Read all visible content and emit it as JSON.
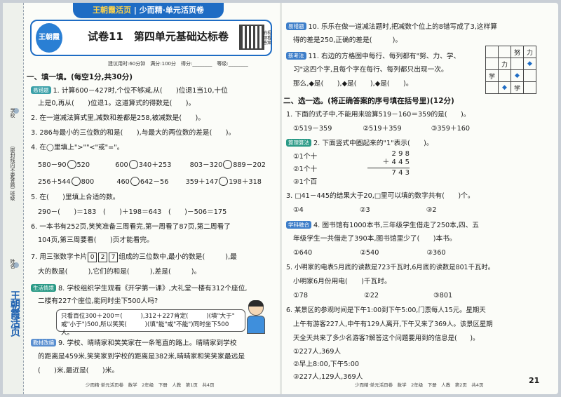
{
  "banner": {
    "brand": "王朝霞活页",
    "series": "少而精·单元活页卷"
  },
  "logo": {
    "text": "王朝霞"
  },
  "title": "试卷11　第四单元基础达标卷",
  "qr_note": "拍视频看答案",
  "meta": "建议用时:60分钟　满分:100分　得分:________　等级:________",
  "binding": {
    "school": "学校",
    "class": "班级",
    "name": "姓名",
    "note": "（密封线内不要答题）",
    "brand": "王朝霞活页"
  },
  "sec1": "一、填一填。(每空1分,共30分)",
  "q1": {
    "tag": "易错题",
    "l1": "1. 计算600－427时,个位不够减,从(　　)位退1当10,十位",
    "l2": "上是0,再从(　　)位退1。这道算式的得数是(　　)。"
  },
  "q2": "2. 在一道减法算式里,减数和差都是258,被减数是(　　)。",
  "q3": "3. 286与最小的三位数的和是(　　),与最大的两位数的差是(　　)。",
  "q4": {
    "l1": "4. 在◯里填上\">\"\"<\"或\"=\"。",
    "r1": [
      "580－90",
      "520",
      "600",
      "340＋253",
      "803－320",
      "889－202"
    ],
    "r2": [
      "256＋544",
      "800",
      "460",
      "642－56",
      "359＋147",
      "198＋318"
    ]
  },
  "q5": {
    "l1": "5. 在(　　)里填上合适的数。",
    "l2": "290－(　　)＝183　(　　)＋198＝643　(　　)－506＝175"
  },
  "q6": {
    "l1": "6. 一本书有252页,笑笑准备三周看完,第一周看了87页,第二周看了",
    "l2": "104页,第三周要看(　　)页才能看完。"
  },
  "q7": {
    "pre": "7. 用三张数字卡片",
    "cards": [
      "0",
      "2",
      "7"
    ],
    "post": "组成的三位数中,最小的数是(　　　),最",
    "l2": "大的数是(　　　),它们的和是(　　　),差是(　　　)。"
  },
  "q8": {
    "tag": "生活情境",
    "l1": "8. 学校组织学生观看《开学第一课》,大礼堂一楼有312个座位,",
    "l2": "二楼有227个座位,能同时坐下500人吗?",
    "h1": "只看百位300＋200＝(　　　),312＋227肯定(　　　)(填\"大于\"",
    "h2": "或\"小于\")500,所以笑笑(　　　)(填\"能\"或\"不能\")同时坐下500人。"
  },
  "q9": {
    "tag": "教材改编",
    "l1": "9. 学校、晴晴家和笑笑家在一条笔直的路上。晴晴家到学校",
    "l2": "的距离是459米,笑笑家到学校的距离是382米,晴晴家和笑笑家最远是",
    "l3": "(　　)米,最近是(　　)米。"
  },
  "q10": {
    "tag": "易错题",
    "l1": "10. 乐乐在做一道减法题时,把减数个位上的8错写成了3,这样算",
    "l2": "得的差是250,正确的差是(　　　)。"
  },
  "q11": {
    "tag": "新考法",
    "l1": "11. 右边的方格图中每行、每列都有\"努、力、学、",
    "l2": "习\"这四个字,且每个字在每行、每列都只出现一次。",
    "l3": "那么,◆是(　　),◆是(　　),◆是(　　)。"
  },
  "grid": [
    [
      "",
      "",
      "努",
      "力"
    ],
    [
      "",
      "力",
      "",
      "◆"
    ],
    [
      "学",
      "",
      "◆",
      ""
    ],
    [
      "",
      "◆",
      "学",
      ""
    ]
  ],
  "sec2": "二、选一选。(将正确答案的序号填在括号里)(12分)",
  "c1": {
    "l1": "1. 下面的式子中,不能用来验算519－160＝359的是(　　)。",
    "opts": [
      "①519－359",
      "②519＋359",
      "③359＋160"
    ]
  },
  "c2": {
    "tag": "算理算法",
    "l1": "2. 下面竖式中圈起来的\"1\"表示(　　)。",
    "opts": [
      "①1个十",
      "②1个十",
      "③1个百"
    ],
    "calc": [
      "2 9 8",
      "＋ 4 4 5",
      "7 4 3"
    ]
  },
  "c3": {
    "l1": "3. □41－445的结果大于20,□里可以填的数字共有(　　)个。",
    "opts": [
      "①4",
      "②3",
      "③2"
    ]
  },
  "c4": {
    "tag": "学科融合",
    "l1": "4. 图书馆有1000本书,三年级学生借走了250本,四、五",
    "l2": "年级学生一共借走了390本,图书馆里少了(　　)本书。",
    "opts": [
      "①640",
      "②540",
      "③360"
    ]
  },
  "c5": {
    "l1": "5. 小明家的电表5月底的读数是723千瓦时,6月底的读数是801千瓦时。",
    "l2": "小明家6月份用电(　　)千瓦时。",
    "opts": [
      "①78",
      "②22",
      "③801"
    ]
  },
  "c6": {
    "l1": "6. 某景区的参观时间是下午1:00到下午5:00,门票每人15元。星期天",
    "l2": "上午有游客227人,中午有129人离开,下午又来了369人。该景区星期",
    "l3": "天全天共来了多少名游客?解答这个问题要用到的信息是(　　)。",
    "opts": [
      "①227人,369人",
      "②早上8:00,下午5:00",
      "③227人,129人,369人"
    ]
  },
  "footer_left": "少而精·单元活页卷　数学　2年级　下册　人教　第1页　共4页",
  "footer_right": "少而精·单元活页卷　数学　2年级　下册　人教　第2页　共4页",
  "page_number": "21"
}
